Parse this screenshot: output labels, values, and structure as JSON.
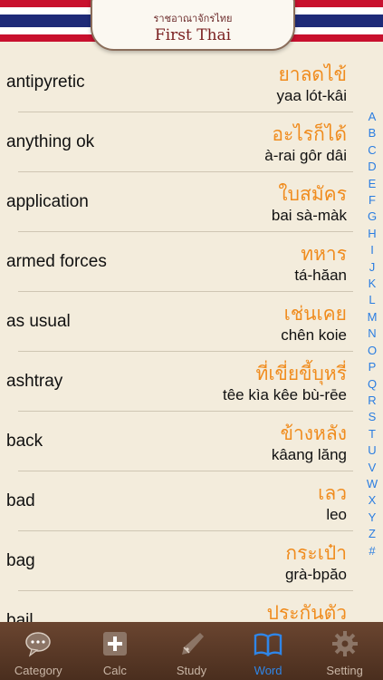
{
  "header": {
    "logo_thai": "ราชอาณาจักรไทย",
    "logo_brand": "First Thai"
  },
  "words": [
    {
      "en": "antipyretic",
      "th": "ยาลดไข้",
      "tr": "yaa lót-kâi"
    },
    {
      "en": "anything ok",
      "th": "อะไรก็ได้",
      "tr": "à-rai gôr dâi"
    },
    {
      "en": "application",
      "th": "ใบสมัคร",
      "tr": "bai sà-màk"
    },
    {
      "en": "armed forces",
      "th": "ทหาร",
      "tr": "tá-hăan"
    },
    {
      "en": "as usual",
      "th": "เช่นเคย",
      "tr": "chên koie"
    },
    {
      "en": "ashtray",
      "th": "ที่เขี่ยขี้บุหรี่",
      "tr": "têe kìa kêe bù-rēe"
    },
    {
      "en": "back",
      "th": "ข้างหลัง",
      "tr": "kâang lăng"
    },
    {
      "en": "bad",
      "th": "เลว",
      "tr": "leo"
    },
    {
      "en": "bag",
      "th": "กระเป๋า",
      "tr": "grà-bpăo"
    },
    {
      "en": "bail",
      "th": "ประกันตัว",
      "tr": ""
    }
  ],
  "index": [
    "A",
    "B",
    "C",
    "D",
    "E",
    "F",
    "G",
    "H",
    "I",
    "J",
    "K",
    "L",
    "M",
    "N",
    "O",
    "P",
    "Q",
    "R",
    "S",
    "T",
    "U",
    "V",
    "W",
    "X",
    "Y",
    "Z",
    "#"
  ],
  "tabs": [
    {
      "label": "Category",
      "icon": "speech-bubble-icon"
    },
    {
      "label": "Calc",
      "icon": "plus-box-icon"
    },
    {
      "label": "Study",
      "icon": "pen-nib-icon"
    },
    {
      "label": "Word",
      "icon": "open-book-icon"
    },
    {
      "label": "Setting",
      "icon": "gear-icon"
    }
  ],
  "active_tab": "Word",
  "colors": {
    "thai_text": "#f08c1e",
    "index_letters": "#2a7de1",
    "active_tab": "#2f86e8"
  }
}
